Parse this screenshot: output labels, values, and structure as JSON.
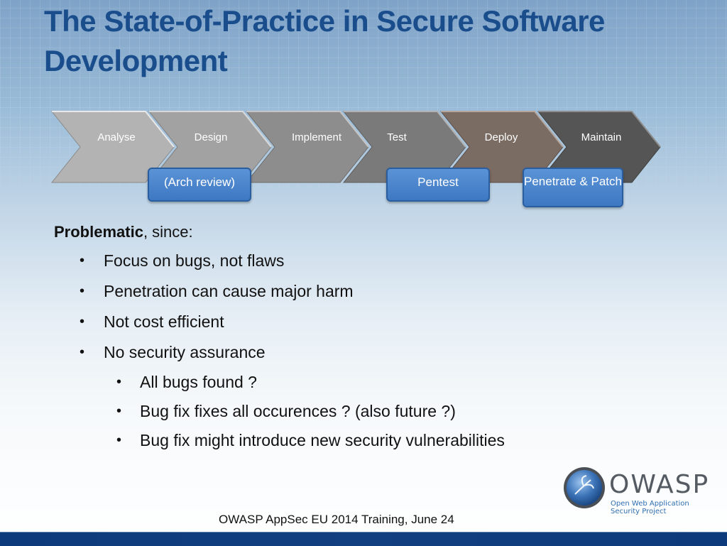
{
  "slide": {
    "title": "The State-of-Practice in Secure Software Development",
    "process": {
      "steps": [
        {
          "label": "Analyse",
          "color": "#b3b3b3"
        },
        {
          "label": "Design",
          "color": "#a2a2a2"
        },
        {
          "label": "Implement",
          "color": "#8d8d8d"
        },
        {
          "label": "Test",
          "color": "#7a7a7a"
        },
        {
          "label": "Deploy",
          "color": "#7a6b63"
        },
        {
          "label": "Maintain",
          "color": "#555555"
        }
      ],
      "callouts": [
        {
          "label": "(Arch review)"
        },
        {
          "label": "Pentest"
        },
        {
          "label": "Penetrate & Patch"
        }
      ]
    },
    "intro_bold": "Problematic",
    "intro_rest": ", since:",
    "bullets": [
      "Focus on bugs, not flaws",
      "Penetration can cause major harm",
      "Not cost efficient",
      "No security assurance"
    ],
    "sub_bullets": [
      "All bugs found ?",
      "Bug fix fixes all occurences ? (also future ?)",
      "Bug fix might introduce new security vulnerabilities"
    ],
    "bullet_glyph": "•",
    "footer": "OWASP AppSec EU 2014 Training, June 24",
    "logo": {
      "word": "OWASP",
      "sub_line1": "Open Web Application",
      "sub_line2": "Security Project",
      "icon": "wasp-globe-icon"
    }
  }
}
